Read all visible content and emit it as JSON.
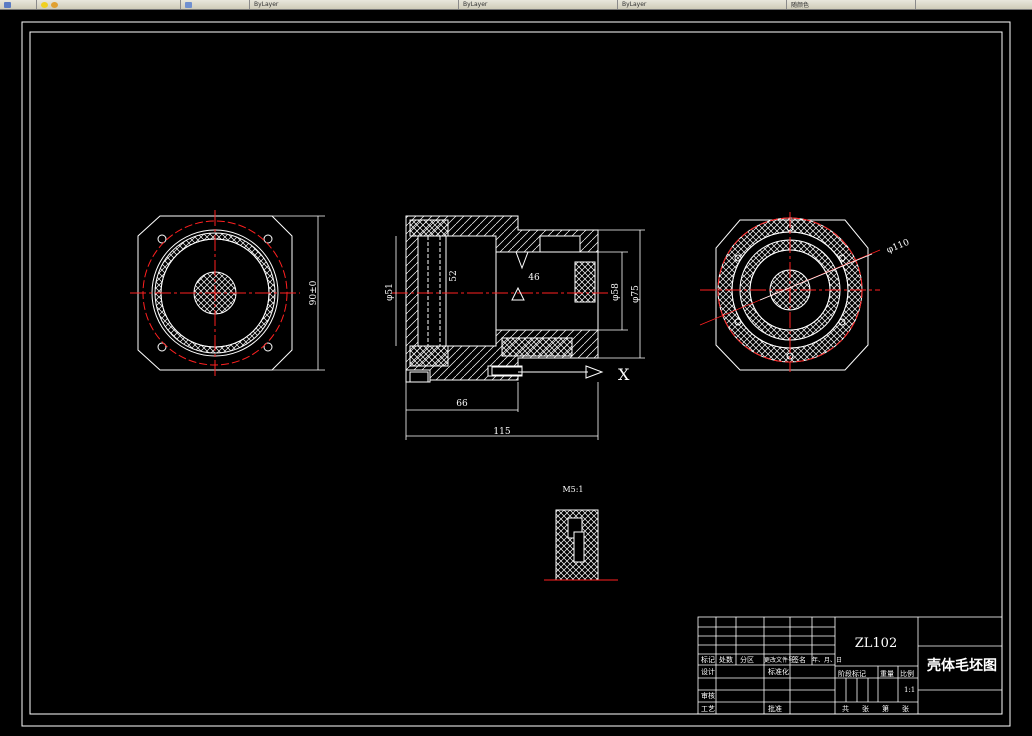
{
  "toolbar": {
    "segments": [
      {
        "name": "layer-control",
        "label": "",
        "icon": "layer-icon"
      },
      {
        "name": "layer-state",
        "label": "",
        "icon": "lightbulb-icon"
      },
      {
        "name": "layer-tools",
        "label": "",
        "icon": "layer-tools-icon"
      },
      {
        "name": "color-control",
        "label": "ByLayer"
      },
      {
        "name": "linetype-control",
        "label": "ByLayer"
      },
      {
        "name": "lineweight-control",
        "label": "ByLayer"
      },
      {
        "name": "plotstyle-control",
        "label": "随颜色"
      }
    ]
  },
  "drawing": {
    "dims": {
      "left_height": "90±0",
      "bore_51": "φ51",
      "bore_52": "52",
      "bore_46": "46",
      "dia_58": "φ58",
      "dia_75": "φ75",
      "len_66": "66",
      "len_115": "115",
      "axis_x": "X",
      "right_dia": "φ110"
    },
    "detail_scale": "M5:1"
  },
  "title_block": {
    "material": "ZL102",
    "drawing_name": "壳体毛坯图",
    "scale": "1:1",
    "headers": {
      "marks": "标记",
      "count": "处数",
      "zone": "分区",
      "change_doc": "更改文件号",
      "signature": "签名",
      "date": "年、月、日",
      "designer": "设计",
      "standardize": "标准化",
      "stage_mark": "阶段标记",
      "weight": "重量",
      "ratio": "比例",
      "review": "审核",
      "process": "工艺",
      "approve": "批准",
      "sheets_total": "共",
      "sheet": "张",
      "sheet_no": "第",
      "sheet_unit": "张"
    }
  },
  "colors": {
    "background": "#000000",
    "lines": "#ffffff",
    "centerline": "#ff2020",
    "hatch": "#ffffff"
  }
}
